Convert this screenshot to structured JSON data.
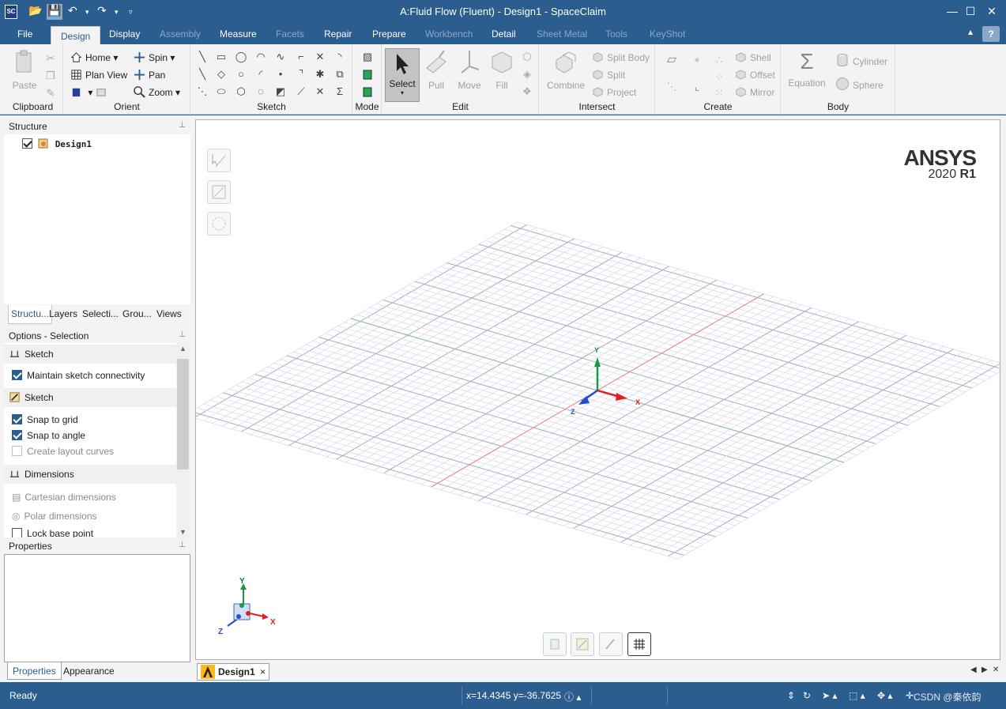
{
  "window": {
    "title": "A:Fluid Flow (Fluent) - Design1 - SpaceClaim",
    "app_logo": "SC",
    "controls": [
      "minimize-icon",
      "maximize-icon",
      "close-icon"
    ]
  },
  "ribbon_tabs": {
    "file": "File",
    "design": "Design",
    "display": "Display",
    "assembly": "Assembly",
    "measure": "Measure",
    "facets": "Facets",
    "repair": "Repair",
    "prepare": "Prepare",
    "workbench": "Workbench",
    "detail": "Detail",
    "sheet_metal": "Sheet Metal",
    "tools": "Tools",
    "keyshot": "KeyShot",
    "help": "?"
  },
  "ribbon": {
    "clipboard": {
      "label": "Clipboard",
      "paste": "Paste"
    },
    "orient": {
      "label": "Orient",
      "home": "Home",
      "plan_view": "Plan View",
      "spin": "Spin",
      "pan": "Pan",
      "zoom": "Zoom"
    },
    "sketch": {
      "label": "Sketch"
    },
    "mode": {
      "label": "Mode"
    },
    "edit": {
      "label": "Edit",
      "select": "Select",
      "pull": "Pull",
      "move": "Move",
      "fill": "Fill"
    },
    "intersect": {
      "label": "Intersect",
      "combine": "Combine",
      "split_body": "Split Body",
      "split": "Split",
      "project": "Project"
    },
    "create": {
      "label": "Create",
      "shell": "Shell",
      "offset": "Offset",
      "mirror": "Mirror"
    },
    "body": {
      "label": "Body",
      "equation": "Equation",
      "cylinder": "Cylinder",
      "sphere": "Sphere"
    }
  },
  "structure": {
    "title": "Structure",
    "tree_item": "Design1",
    "tabs": [
      "Structu...",
      "Layers",
      "Selecti...",
      "Grou...",
      "Views"
    ]
  },
  "options": {
    "title": "Options - Selection",
    "section1": "Sketch",
    "maintain_connectivity": "Maintain sketch connectivity",
    "section2": "Sketch",
    "snap_grid": "Snap to grid",
    "snap_angle": "Snap to angle",
    "create_layout": "Create layout curves",
    "section3": "Dimensions",
    "cartesian": "Cartesian dimensions",
    "polar": "Polar dimensions",
    "lock_base": "Lock base point"
  },
  "properties": {
    "title": "Properties",
    "tabs": [
      "Properties",
      "Appearance"
    ]
  },
  "viewport": {
    "brand_name": "ANSYS",
    "brand_version": "2020",
    "brand_release": "R1",
    "axis_x": "X",
    "axis_y": "Y",
    "axis_z": "Z"
  },
  "doc_tab": {
    "name": "Design1",
    "close": "×"
  },
  "statusbar": {
    "status": "Ready",
    "coords": "x=14.4345  y=-36.7625",
    "watermark": "CSDN @秦依韵"
  },
  "colors": {
    "chrome": "#2b5d8e",
    "ribbon_bg": "#f3f3f3",
    "axis_x": "#e02020",
    "axis_y": "#1a9a3a",
    "axis_z": "#2050d0"
  }
}
